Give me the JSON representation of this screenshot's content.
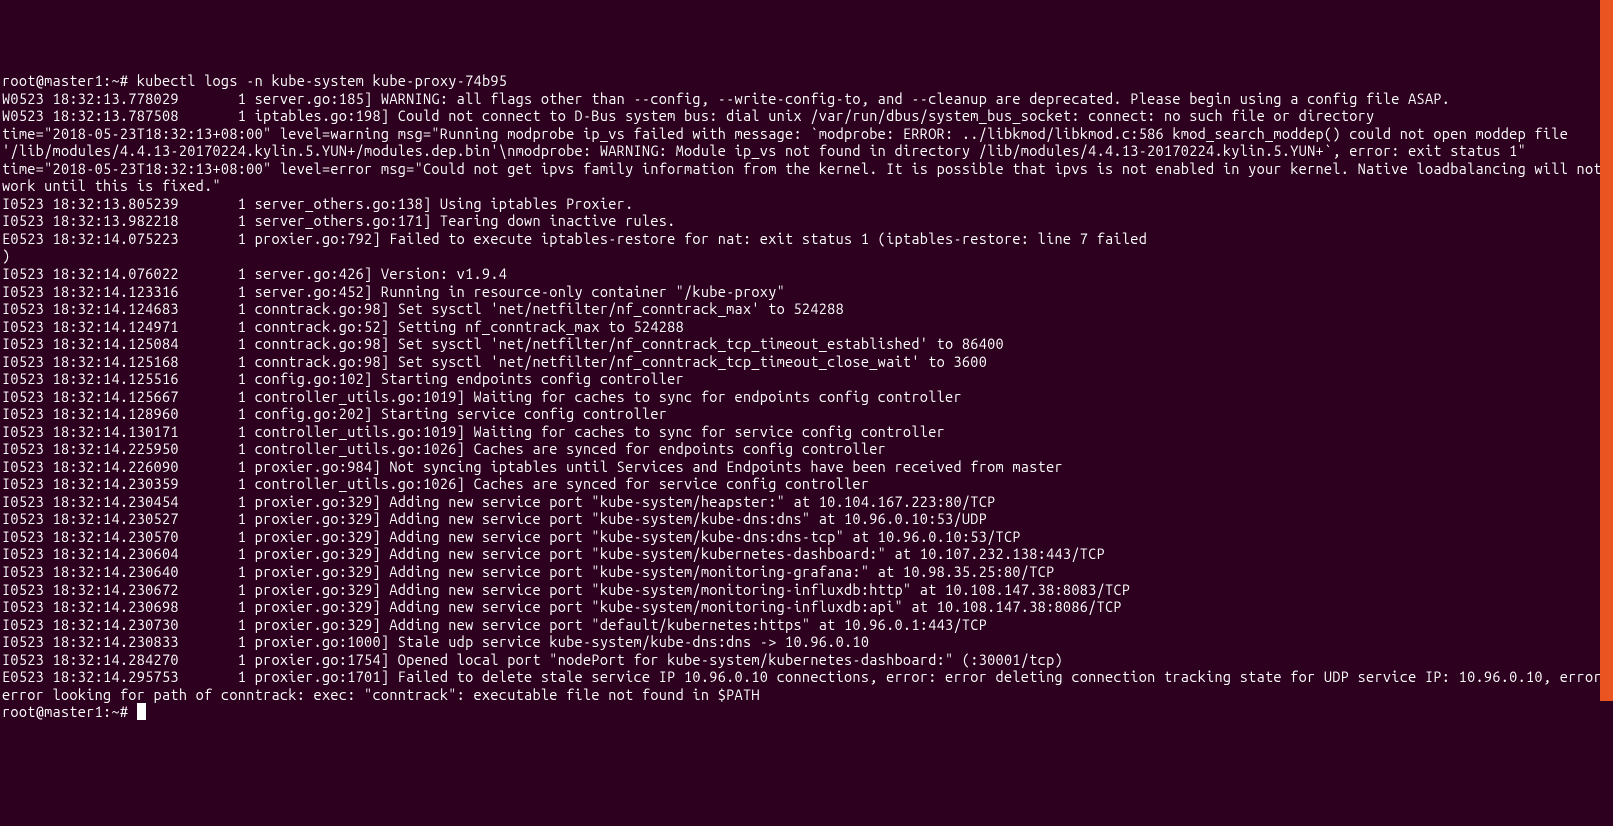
{
  "prompt1": "root@master1:~# ",
  "command": "kubectl logs -n kube-system kube-proxy-74b95",
  "lines": [
    "W0523 18:32:13.778029       1 server.go:185] WARNING: all flags other than --config, --write-config-to, and --cleanup are deprecated. Please begin using a config file ASAP.",
    "W0523 18:32:13.787508       1 iptables.go:198] Could not connect to D-Bus system bus: dial unix /var/run/dbus/system_bus_socket: connect: no such file or directory",
    "time=\"2018-05-23T18:32:13+08:00\" level=warning msg=\"Running modprobe ip_vs failed with message: `modprobe: ERROR: ../libkmod/libkmod.c:586 kmod_search_moddep() could not open moddep file '/lib/modules/4.4.13-20170224.kylin.5.YUN+/modules.dep.bin'\\nmodprobe: WARNING: Module ip_vs not found in directory /lib/modules/4.4.13-20170224.kylin.5.YUN+`, error: exit status 1\"",
    "time=\"2018-05-23T18:32:13+08:00\" level=error msg=\"Could not get ipvs family information from the kernel. It is possible that ipvs is not enabled in your kernel. Native loadbalancing will not work until this is fixed.\"",
    "I0523 18:32:13.805239       1 server_others.go:138] Using iptables Proxier.",
    "I0523 18:32:13.982218       1 server_others.go:171] Tearing down inactive rules.",
    "E0523 18:32:14.075223       1 proxier.go:792] Failed to execute iptables-restore for nat: exit status 1 (iptables-restore: line 7 failed",
    ")",
    "I0523 18:32:14.076022       1 server.go:426] Version: v1.9.4",
    "I0523 18:32:14.123316       1 server.go:452] Running in resource-only container \"/kube-proxy\"",
    "I0523 18:32:14.124683       1 conntrack.go:98] Set sysctl 'net/netfilter/nf_conntrack_max' to 524288",
    "I0523 18:32:14.124971       1 conntrack.go:52] Setting nf_conntrack_max to 524288",
    "I0523 18:32:14.125084       1 conntrack.go:98] Set sysctl 'net/netfilter/nf_conntrack_tcp_timeout_established' to 86400",
    "I0523 18:32:14.125168       1 conntrack.go:98] Set sysctl 'net/netfilter/nf_conntrack_tcp_timeout_close_wait' to 3600",
    "I0523 18:32:14.125516       1 config.go:102] Starting endpoints config controller",
    "I0523 18:32:14.125667       1 controller_utils.go:1019] Waiting for caches to sync for endpoints config controller",
    "I0523 18:32:14.128960       1 config.go:202] Starting service config controller",
    "I0523 18:32:14.130171       1 controller_utils.go:1019] Waiting for caches to sync for service config controller",
    "I0523 18:32:14.225950       1 controller_utils.go:1026] Caches are synced for endpoints config controller",
    "I0523 18:32:14.226090       1 proxier.go:984] Not syncing iptables until Services and Endpoints have been received from master",
    "I0523 18:32:14.230359       1 controller_utils.go:1026] Caches are synced for service config controller",
    "I0523 18:32:14.230454       1 proxier.go:329] Adding new service port \"kube-system/heapster:\" at 10.104.167.223:80/TCP",
    "I0523 18:32:14.230527       1 proxier.go:329] Adding new service port \"kube-system/kube-dns:dns\" at 10.96.0.10:53/UDP",
    "I0523 18:32:14.230570       1 proxier.go:329] Adding new service port \"kube-system/kube-dns:dns-tcp\" at 10.96.0.10:53/TCP",
    "I0523 18:32:14.230604       1 proxier.go:329] Adding new service port \"kube-system/kubernetes-dashboard:\" at 10.107.232.138:443/TCP",
    "I0523 18:32:14.230640       1 proxier.go:329] Adding new service port \"kube-system/monitoring-grafana:\" at 10.98.35.25:80/TCP",
    "I0523 18:32:14.230672       1 proxier.go:329] Adding new service port \"kube-system/monitoring-influxdb:http\" at 10.108.147.38:8083/TCP",
    "I0523 18:32:14.230698       1 proxier.go:329] Adding new service port \"kube-system/monitoring-influxdb:api\" at 10.108.147.38:8086/TCP",
    "I0523 18:32:14.230730       1 proxier.go:329] Adding new service port \"default/kubernetes:https\" at 10.96.0.1:443/TCP",
    "I0523 18:32:14.230833       1 proxier.go:1000] Stale udp service kube-system/kube-dns:dns -> 10.96.0.10",
    "I0523 18:32:14.284270       1 proxier.go:1754] Opened local port \"nodePort for kube-system/kubernetes-dashboard:\" (:30001/tcp)",
    "E0523 18:32:14.295753       1 proxier.go:1701] Failed to delete stale service IP 10.96.0.10 connections, error: error deleting connection tracking state for UDP service IP: 10.96.0.10, error: error looking for path of conntrack: exec: \"conntrack\": executable file not found in $PATH"
  ],
  "prompt2": "root@master1:~# "
}
